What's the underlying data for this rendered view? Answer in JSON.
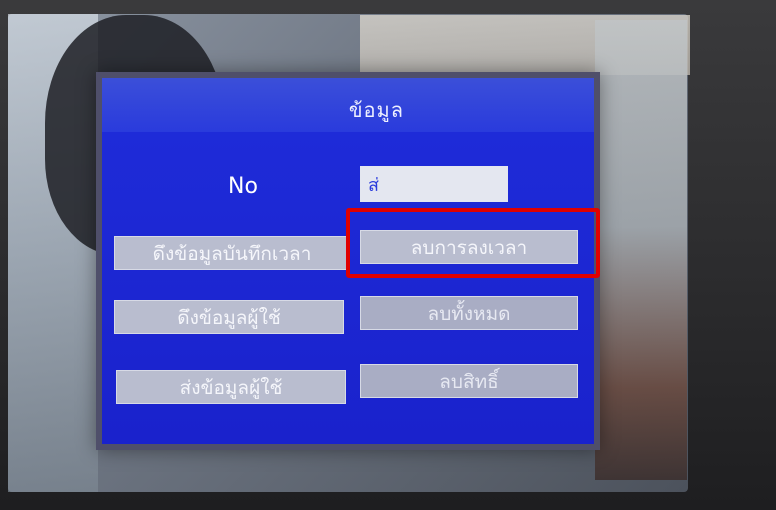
{
  "screen": {
    "title": "ข้อมูล",
    "no_label": "No",
    "no_value": "ส่",
    "buttons": {
      "download_attendance": "ดึงข้อมูลบันทึกเวลา",
      "delete_attendance": "ลบการลงเวลา",
      "download_users": "ดึงข้อมูลผู้ใช้",
      "delete_all": "ลบทั้งหมด",
      "upload_users": "ส่งข้อมูลผู้ใช้",
      "delete_rights": "ลบสิทธิ์"
    }
  },
  "colors": {
    "lcd_background": "#1f2bd6",
    "button": "#b9bdcf",
    "highlight": "#e00000"
  }
}
